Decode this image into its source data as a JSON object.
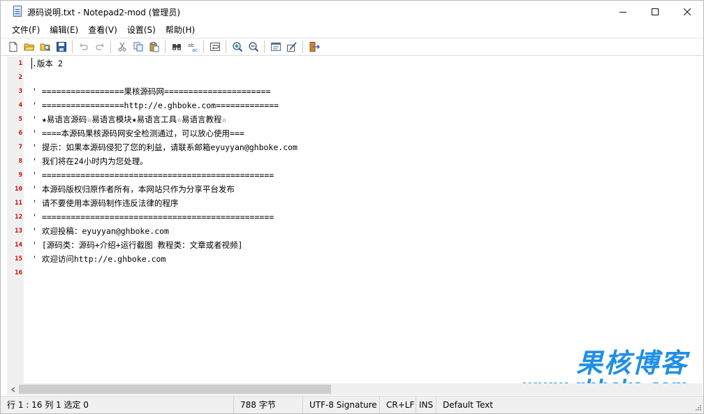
{
  "window": {
    "title": "源码说明.txt - Notepad2-mod (管理员)",
    "controls": {
      "minimize": "minimize",
      "maximize": "maximize",
      "close": "close"
    }
  },
  "menu": [
    {
      "label": "文件(F)"
    },
    {
      "label": "编辑(E)"
    },
    {
      "label": "查看(V)"
    },
    {
      "label": "设置(S)"
    },
    {
      "label": "帮助(H)"
    }
  ],
  "toolbar": [
    "new-file-icon",
    "open-folder-icon",
    "browse-icon",
    "save-icon",
    "undo-icon",
    "redo-icon",
    "cut-icon",
    "copy-icon",
    "paste-icon",
    "find-icon",
    "replace-icon",
    "word-wrap-icon",
    "zoom-in-icon",
    "zoom-out-icon",
    "scheme-icon",
    "customize-icon",
    "exit-icon"
  ],
  "editor": {
    "lines": [
      {
        "num": "1",
        "text": ".版本 2"
      },
      {
        "num": "2",
        "text": ""
      },
      {
        "num": "3",
        "text": "' =================果核源码网======================"
      },
      {
        "num": "4",
        "text": "' =================http://e.ghboke.com============="
      },
      {
        "num": "5",
        "text": "' ★易语言源码☆易语言模块★易语言工具☆易语言教程☆"
      },
      {
        "num": "6",
        "text": "' ====本源码果核源码网安全检测通过，可以放心使用==="
      },
      {
        "num": "7",
        "text": "' 提示：如果本源码侵犯了您的利益，请联系邮箱eyuyyan@ghboke.com"
      },
      {
        "num": "8",
        "text": "' 我们将在24小时内为您处理。"
      },
      {
        "num": "9",
        "text": "' ================================================"
      },
      {
        "num": "10",
        "text": "' 本源码版权归原作者所有，本网站只作为分享平台发布"
      },
      {
        "num": "11",
        "text": "' 请不要使用本源码制作违反法律的程序"
      },
      {
        "num": "12",
        "text": "' ================================================"
      },
      {
        "num": "13",
        "text": "' 欢迎投稿：eyuyyan@ghboke.com"
      },
      {
        "num": "14",
        "text": "' [源码类：源码+介绍+运行截图 教程类：文章或者视频]"
      },
      {
        "num": "15",
        "text": "' 欢迎访问http://e.ghboke.com"
      },
      {
        "num": "16",
        "text": ""
      }
    ]
  },
  "watermark": {
    "line1": "果核博客",
    "line2": "www.ghboke.com"
  },
  "statusbar": {
    "position": "行 1 : 16   列 1   选定 0",
    "size": "788 字节",
    "encoding": "UTF-8 Signature",
    "eol": "CR+LF",
    "ovr": "INS",
    "scheme": "Default Text"
  },
  "colors": {
    "line_number": "#d00000",
    "gutter": "#f0f0f0",
    "watermark": "#1f8fe6",
    "statusbar": "#f0f0f0"
  }
}
